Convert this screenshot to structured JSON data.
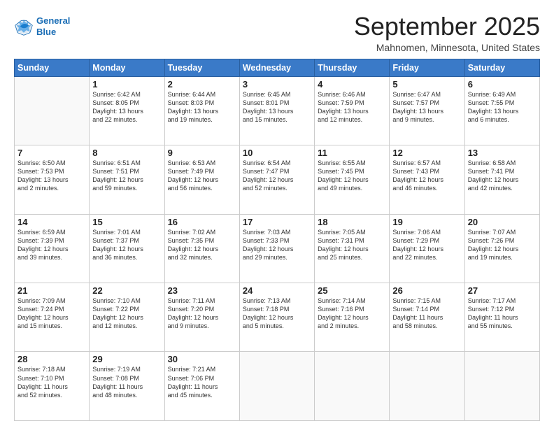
{
  "header": {
    "logo_line1": "General",
    "logo_line2": "Blue",
    "month": "September 2025",
    "location": "Mahnomen, Minnesota, United States"
  },
  "weekdays": [
    "Sunday",
    "Monday",
    "Tuesday",
    "Wednesday",
    "Thursday",
    "Friday",
    "Saturday"
  ],
  "weeks": [
    [
      {
        "day": "",
        "info": ""
      },
      {
        "day": "1",
        "info": "Sunrise: 6:42 AM\nSunset: 8:05 PM\nDaylight: 13 hours\nand 22 minutes."
      },
      {
        "day": "2",
        "info": "Sunrise: 6:44 AM\nSunset: 8:03 PM\nDaylight: 13 hours\nand 19 minutes."
      },
      {
        "day": "3",
        "info": "Sunrise: 6:45 AM\nSunset: 8:01 PM\nDaylight: 13 hours\nand 15 minutes."
      },
      {
        "day": "4",
        "info": "Sunrise: 6:46 AM\nSunset: 7:59 PM\nDaylight: 13 hours\nand 12 minutes."
      },
      {
        "day": "5",
        "info": "Sunrise: 6:47 AM\nSunset: 7:57 PM\nDaylight: 13 hours\nand 9 minutes."
      },
      {
        "day": "6",
        "info": "Sunrise: 6:49 AM\nSunset: 7:55 PM\nDaylight: 13 hours\nand 6 minutes."
      }
    ],
    [
      {
        "day": "7",
        "info": "Sunrise: 6:50 AM\nSunset: 7:53 PM\nDaylight: 13 hours\nand 2 minutes."
      },
      {
        "day": "8",
        "info": "Sunrise: 6:51 AM\nSunset: 7:51 PM\nDaylight: 12 hours\nand 59 minutes."
      },
      {
        "day": "9",
        "info": "Sunrise: 6:53 AM\nSunset: 7:49 PM\nDaylight: 12 hours\nand 56 minutes."
      },
      {
        "day": "10",
        "info": "Sunrise: 6:54 AM\nSunset: 7:47 PM\nDaylight: 12 hours\nand 52 minutes."
      },
      {
        "day": "11",
        "info": "Sunrise: 6:55 AM\nSunset: 7:45 PM\nDaylight: 12 hours\nand 49 minutes."
      },
      {
        "day": "12",
        "info": "Sunrise: 6:57 AM\nSunset: 7:43 PM\nDaylight: 12 hours\nand 46 minutes."
      },
      {
        "day": "13",
        "info": "Sunrise: 6:58 AM\nSunset: 7:41 PM\nDaylight: 12 hours\nand 42 minutes."
      }
    ],
    [
      {
        "day": "14",
        "info": "Sunrise: 6:59 AM\nSunset: 7:39 PM\nDaylight: 12 hours\nand 39 minutes."
      },
      {
        "day": "15",
        "info": "Sunrise: 7:01 AM\nSunset: 7:37 PM\nDaylight: 12 hours\nand 36 minutes."
      },
      {
        "day": "16",
        "info": "Sunrise: 7:02 AM\nSunset: 7:35 PM\nDaylight: 12 hours\nand 32 minutes."
      },
      {
        "day": "17",
        "info": "Sunrise: 7:03 AM\nSunset: 7:33 PM\nDaylight: 12 hours\nand 29 minutes."
      },
      {
        "day": "18",
        "info": "Sunrise: 7:05 AM\nSunset: 7:31 PM\nDaylight: 12 hours\nand 25 minutes."
      },
      {
        "day": "19",
        "info": "Sunrise: 7:06 AM\nSunset: 7:29 PM\nDaylight: 12 hours\nand 22 minutes."
      },
      {
        "day": "20",
        "info": "Sunrise: 7:07 AM\nSunset: 7:26 PM\nDaylight: 12 hours\nand 19 minutes."
      }
    ],
    [
      {
        "day": "21",
        "info": "Sunrise: 7:09 AM\nSunset: 7:24 PM\nDaylight: 12 hours\nand 15 minutes."
      },
      {
        "day": "22",
        "info": "Sunrise: 7:10 AM\nSunset: 7:22 PM\nDaylight: 12 hours\nand 12 minutes."
      },
      {
        "day": "23",
        "info": "Sunrise: 7:11 AM\nSunset: 7:20 PM\nDaylight: 12 hours\nand 9 minutes."
      },
      {
        "day": "24",
        "info": "Sunrise: 7:13 AM\nSunset: 7:18 PM\nDaylight: 12 hours\nand 5 minutes."
      },
      {
        "day": "25",
        "info": "Sunrise: 7:14 AM\nSunset: 7:16 PM\nDaylight: 12 hours\nand 2 minutes."
      },
      {
        "day": "26",
        "info": "Sunrise: 7:15 AM\nSunset: 7:14 PM\nDaylight: 11 hours\nand 58 minutes."
      },
      {
        "day": "27",
        "info": "Sunrise: 7:17 AM\nSunset: 7:12 PM\nDaylight: 11 hours\nand 55 minutes."
      }
    ],
    [
      {
        "day": "28",
        "info": "Sunrise: 7:18 AM\nSunset: 7:10 PM\nDaylight: 11 hours\nand 52 minutes."
      },
      {
        "day": "29",
        "info": "Sunrise: 7:19 AM\nSunset: 7:08 PM\nDaylight: 11 hours\nand 48 minutes."
      },
      {
        "day": "30",
        "info": "Sunrise: 7:21 AM\nSunset: 7:06 PM\nDaylight: 11 hours\nand 45 minutes."
      },
      {
        "day": "",
        "info": ""
      },
      {
        "day": "",
        "info": ""
      },
      {
        "day": "",
        "info": ""
      },
      {
        "day": "",
        "info": ""
      }
    ]
  ]
}
